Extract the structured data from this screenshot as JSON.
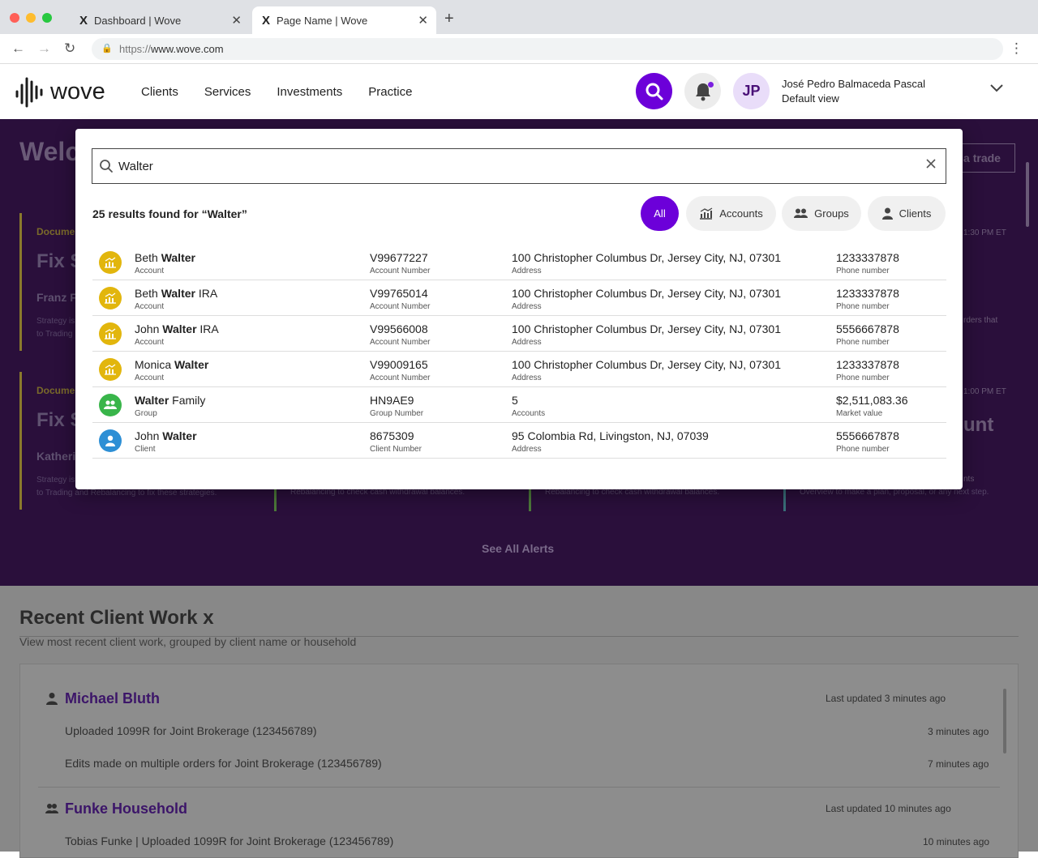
{
  "browser": {
    "tabs": [
      {
        "logo": "X",
        "title": "Dashboard | Wove",
        "close": "✕"
      },
      {
        "logo": "X",
        "title": "Page Name | Wove",
        "close": "✕"
      }
    ],
    "new_tab": "+",
    "url_scheme": "https://",
    "url_host": "www.wove.com"
  },
  "header": {
    "brand": "wove",
    "nav": [
      "Clients",
      "Services",
      "Investments",
      "Practice"
    ],
    "avatar_initials": "JP",
    "user_name": "José Pedro Balmaceda Pascal",
    "user_view": "Default view"
  },
  "background": {
    "welcome": "Welc",
    "trade_button": "a trade",
    "cards": [
      {
        "caption": "Docume",
        "title": "Fix S",
        "who": "Franz F",
        "desc1": "Strategy is",
        "desc2": "to Trading"
      },
      {
        "caption": "Docume",
        "title": "Fix S",
        "who": "Katheri",
        "desc1": "Strategy is",
        "desc2": "to Trading and Rebalancing to fix these strategies."
      }
    ],
    "time1": "1:30 PM ET",
    "time2": "1:00 PM ET",
    "side1": "rders that",
    "side2": "nts",
    "side_word": "unt",
    "mid_desc1": "Rebalancing to check cash withdrawal balances.",
    "mid_desc2": "Rebalancing to check cash withdrawal balances.",
    "right_desc": "Overview to make a plan, proposal, or any next step.",
    "see_all": "See All Alerts",
    "recent_title": "Recent Client Work x",
    "recent_sub": "View most recent client work, grouped by client name or household",
    "recent_groups": [
      {
        "name": "Michael Bluth",
        "updated": "Last updated 3 minutes ago",
        "items": [
          {
            "text": "Uploaded 1099R for Joint Brokerage (123456789)",
            "time": "3 minutes ago"
          },
          {
            "text": "Edits made on multiple orders for Joint Brokerage (123456789)",
            "time": "7 minutes ago"
          }
        ]
      },
      {
        "name": "Funke Household",
        "updated": "Last updated 10 minutes ago",
        "items": [
          {
            "text": "Tobias Funke | Uploaded 1099R for Joint Brokerage (123456789)",
            "time": "10 minutes ago"
          }
        ]
      }
    ]
  },
  "search": {
    "query": "Walter",
    "results_text": "25 results found for “Walter”",
    "filters": [
      "All",
      "Accounts",
      "Groups",
      "Clients"
    ],
    "active_filter": "All",
    "results": [
      {
        "type": "account",
        "pre": "Beth ",
        "match": "Walter",
        "post": "",
        "kind": "Account",
        "id": "V99677227",
        "id_label": "Account Number",
        "col3": "100 Christopher Columbus Dr, Jersey City, NJ, 07301",
        "col3_label": "Address",
        "col4": "1233337878",
        "col4_label": "Phone number"
      },
      {
        "type": "account",
        "pre": "Beth ",
        "match": "Walter",
        "post": " IRA",
        "kind": "Account",
        "id": "V99765014",
        "id_label": "Account Number",
        "col3": "100 Christopher Columbus Dr, Jersey City, NJ, 07301",
        "col3_label": "Address",
        "col4": "1233337878",
        "col4_label": "Phone number"
      },
      {
        "type": "account",
        "pre": "John ",
        "match": "Walter",
        "post": " IRA",
        "kind": "Account",
        "id": "V99566008",
        "id_label": "Account Number",
        "col3": "100 Christopher Columbus Dr, Jersey City, NJ, 07301",
        "col3_label": "Address",
        "col4": "5556667878",
        "col4_label": "Phone number"
      },
      {
        "type": "account",
        "pre": "Monica ",
        "match": "Walter",
        "post": "",
        "kind": "Account",
        "id": "V99009165",
        "id_label": "Account Number",
        "col3": "100 Christopher Columbus Dr, Jersey City, NJ, 07301",
        "col3_label": "Address",
        "col4": "1233337878",
        "col4_label": "Phone number"
      },
      {
        "type": "group",
        "pre": "",
        "match": "Walter",
        "post": " Family",
        "kind": "Group",
        "id": "HN9AE9",
        "id_label": "Group Number",
        "col3": "5",
        "col3_label": "Accounts",
        "col4": "$2,511,083.36",
        "col4_label": "Market value"
      },
      {
        "type": "client",
        "pre": "John ",
        "match": "Walter",
        "post": "",
        "kind": "Client",
        "id": "8675309",
        "id_label": "Client Number",
        "col3": "95 Colombia Rd, Livingston, NJ, 07039",
        "col3_label": "Address",
        "col4": "5556667878",
        "col4_label": "Phone number"
      }
    ]
  },
  "colors": {
    "brand_purple": "#6c00d9",
    "account_icon": "#e2b60d",
    "group_icon": "#39b54a",
    "client_icon": "#2d8fd5",
    "hero_bg": "#2a0f3b"
  },
  "icons": {
    "search": "search-icon",
    "bell": "bell-icon",
    "chevron": "chevron-down-icon",
    "account": "chart-icon",
    "group": "people-icon",
    "client": "person-icon",
    "clear": "close-icon"
  }
}
